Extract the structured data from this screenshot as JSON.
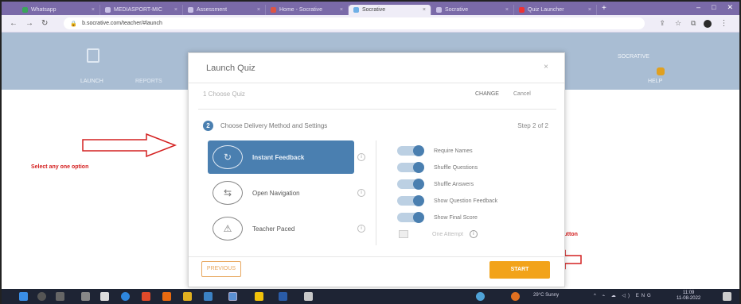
{
  "browser": {
    "tabs": [
      {
        "label": "Whatsapp",
        "kind": "ws",
        "active": false
      },
      {
        "label": "MEDIASPORT-MIC",
        "kind": "",
        "active": false
      },
      {
        "label": "Assessment",
        "kind": "",
        "active": false
      },
      {
        "label": "Home - Socrative",
        "kind": "gm",
        "active": false
      },
      {
        "label": "Socrative",
        "kind": "",
        "active": true
      },
      {
        "label": "Socrative",
        "kind": "",
        "active": false
      },
      {
        "label": "Quiz Launcher",
        "kind": "yt",
        "active": false
      }
    ],
    "new_tab": "+",
    "url": "b.socrative.com/teacher/#launch",
    "window_controls": [
      "–",
      "□",
      "✕"
    ]
  },
  "app": {
    "nav_launch": "LAUNCH",
    "nav_reports": "REPORTS",
    "user_name": "SOCRATIVE",
    "help_label": "HELP"
  },
  "annotations": {
    "left": "Select any one option",
    "right": "click on start button"
  },
  "modal": {
    "title": "Launch Quiz",
    "close": "×",
    "quiz_name": "1 Choose Quiz",
    "change": "CHANGE",
    "cancel": "Cancel",
    "step_badge": "2",
    "step_title": "Choose Delivery Method and Settings",
    "step_count": "Step 2 of 2",
    "methods": [
      {
        "label": "Instant Feedback",
        "icon": "↻",
        "selected": true
      },
      {
        "label": "Open Navigation",
        "icon": "⇆",
        "selected": false
      },
      {
        "label": "Teacher Paced",
        "icon": "⚠",
        "selected": false
      }
    ],
    "settings": [
      {
        "label": "Require Names",
        "on": true
      },
      {
        "label": "Shuffle Questions",
        "on": true
      },
      {
        "label": "Shuffle Answers",
        "on": true
      },
      {
        "label": "Show Question Feedback",
        "on": true
      },
      {
        "label": "Show Final Score",
        "on": true
      }
    ],
    "one_attempt_label": "One Attempt",
    "prev_button": "PREVIOUS",
    "next_button": "START"
  },
  "taskbar": {
    "weather": "29°C Sunny",
    "time": "11:09",
    "date": "11-08-2022",
    "tray": "^ ⌁ ☁ ◁) ENG"
  },
  "colors": {
    "tabbar": "#7a6aa8",
    "header": "#a9bdd3",
    "accent_blue": "#4a7fb0",
    "start_orange": "#f2a31a",
    "annotation_red": "#d42020"
  }
}
